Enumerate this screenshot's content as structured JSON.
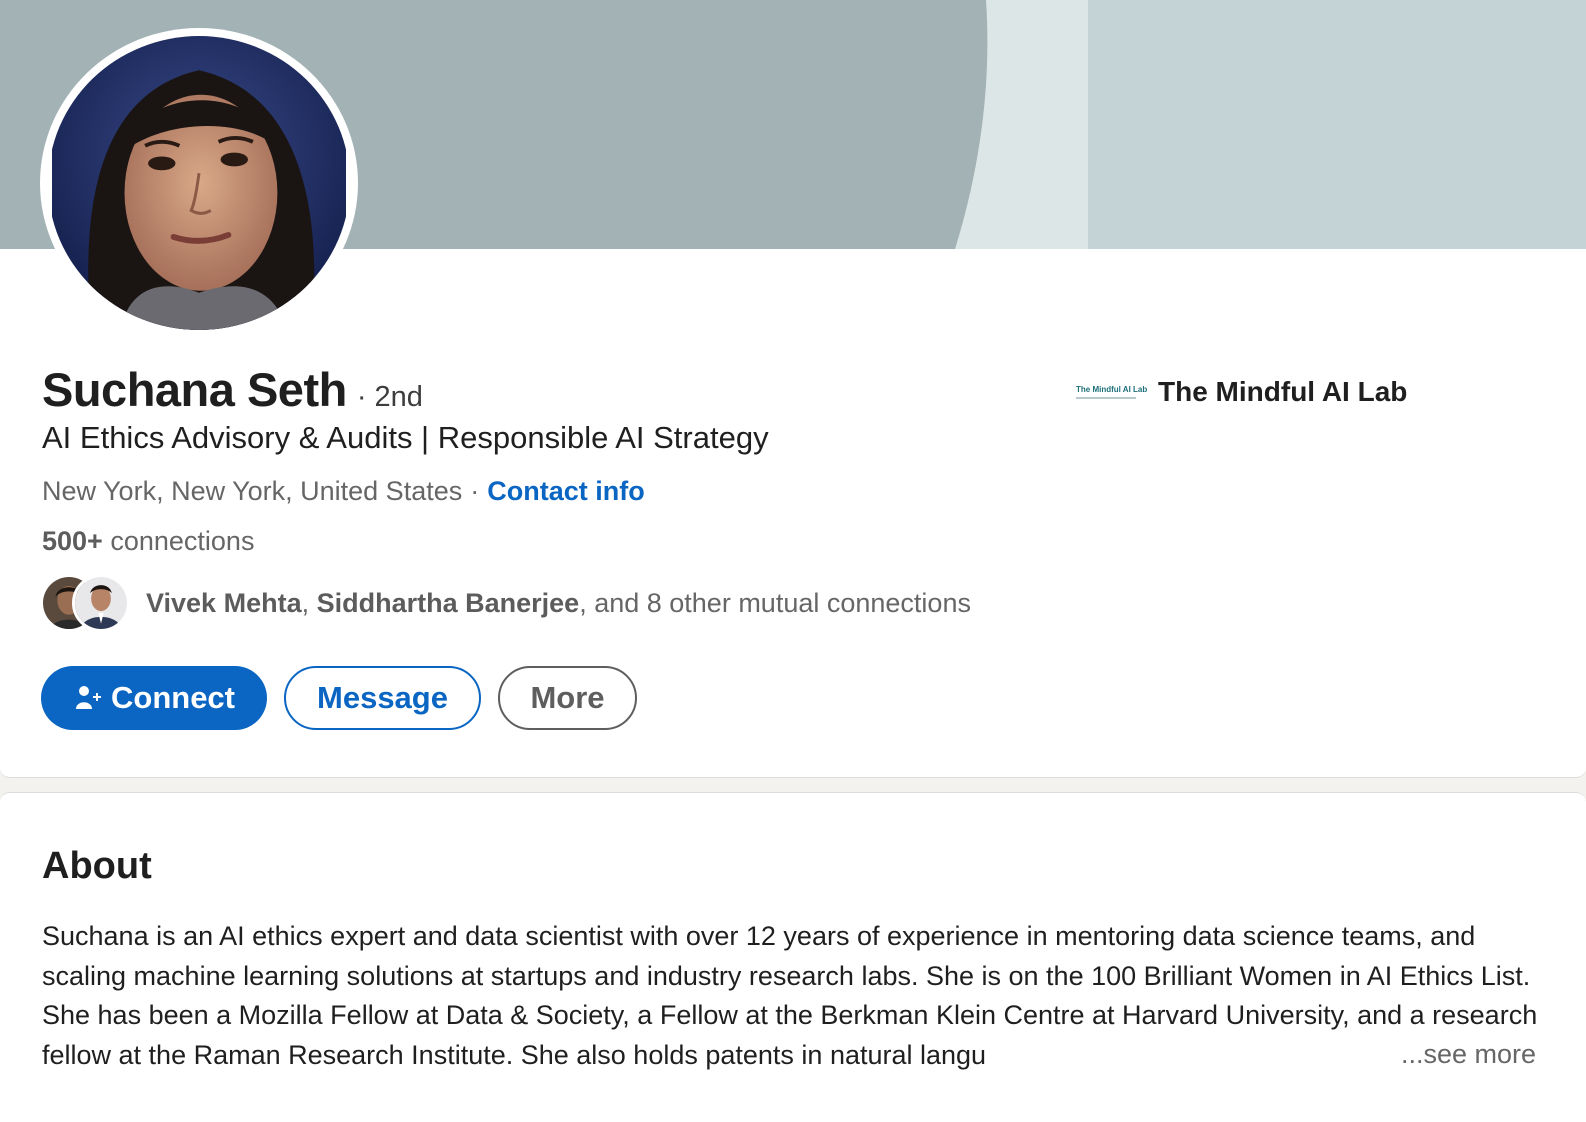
{
  "profile": {
    "name": "Suchana Seth",
    "degree": "· 2nd",
    "headline": "AI Ethics Advisory & Audits | Responsible AI Strategy",
    "location": "New York, New York, United States",
    "location_sep": "·",
    "contact_label": "Contact info",
    "connections_count": "500+",
    "connections_label": "connections",
    "mutual": {
      "name1": "Vivek Mehta",
      "sep": ",",
      "name2": "Siddhartha Banerjee",
      "rest": ", and 8 other mutual connections"
    }
  },
  "actions": {
    "connect": "Connect",
    "message": "Message",
    "more": "More"
  },
  "company": {
    "logo_text": "The Mindful AI Lab",
    "name": "The Mindful AI Lab"
  },
  "about": {
    "title": "About",
    "text": "Suchana is an AI ethics expert and data scientist with over 12 years of experience in mentoring data science teams, and scaling machine learning solutions at startups and industry research labs. She is on the 100 Brilliant Women in AI Ethics List. She has been a Mozilla Fellow at Data & Society, a Fellow at the Berkman Klein Centre at Harvard University, and a research fellow at the Raman Research Institute. She also holds patents in natural langu",
    "see_more": "...see more"
  },
  "colors": {
    "accent": "#0a66c2",
    "banner_dark": "#a3b2b5",
    "banner_light": "#dde6e7",
    "banner_right": "#c3d3d6"
  },
  "icons": {
    "connect": "person-plus-icon"
  }
}
